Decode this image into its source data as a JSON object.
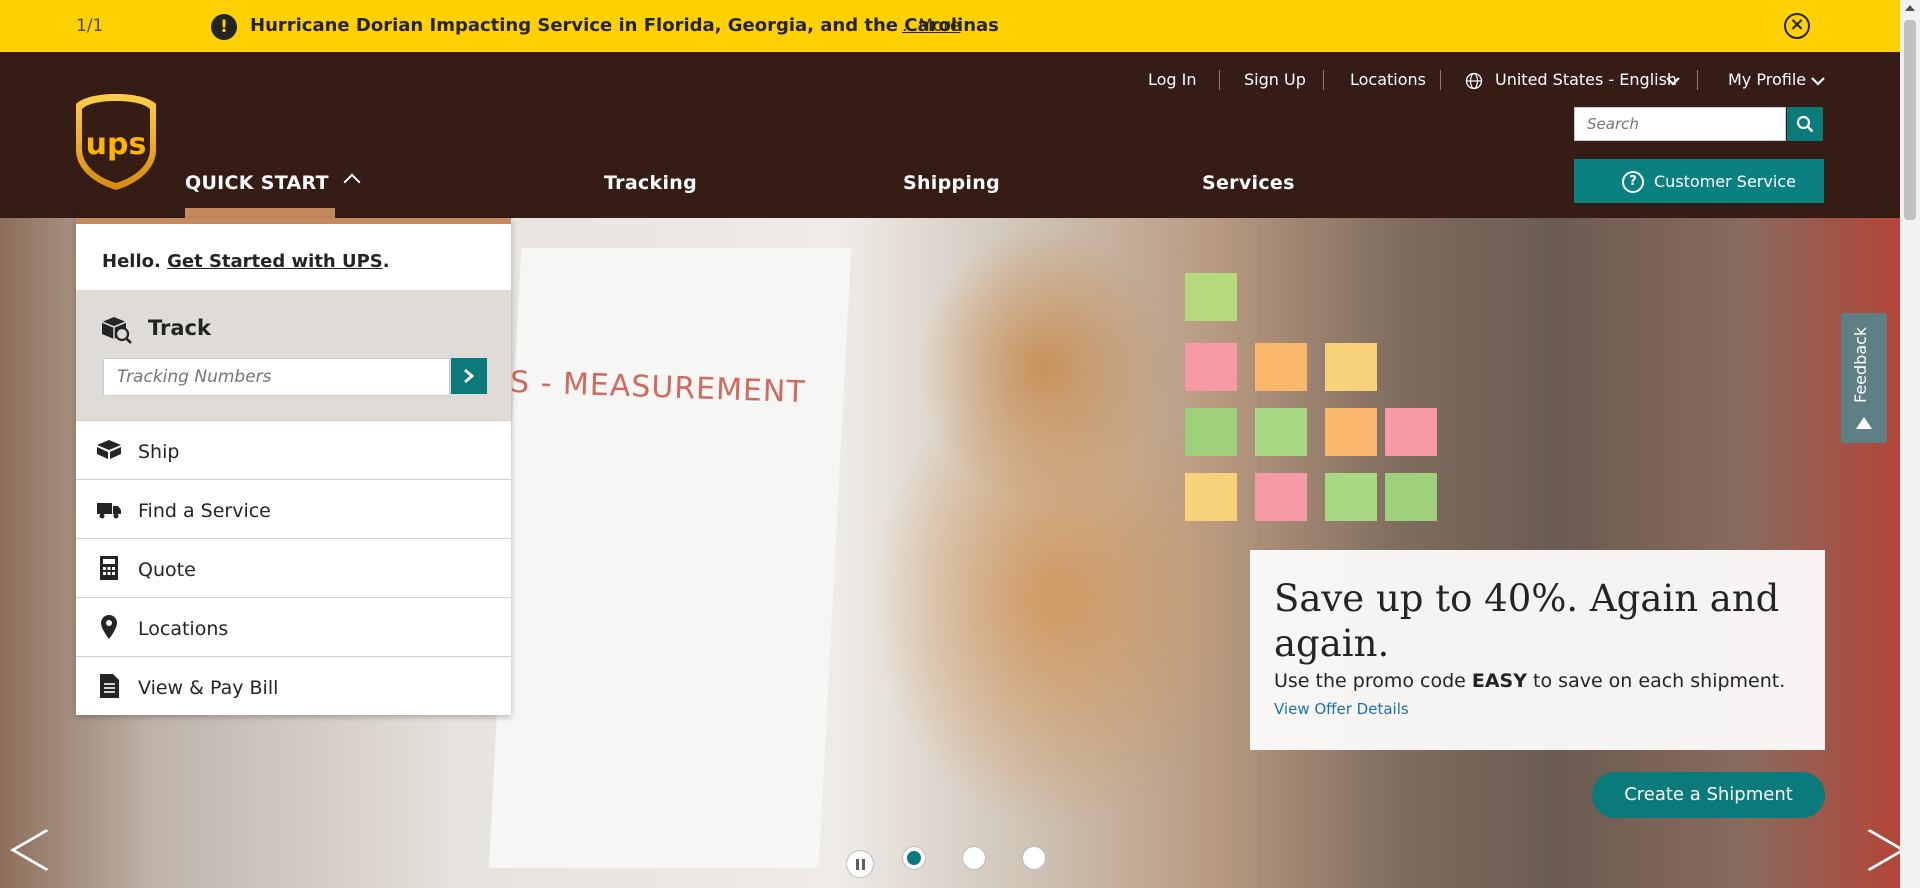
{
  "alert": {
    "counter": "1/1",
    "message": "Hurricane Dorian Impacting Service in Florida, Georgia, and the Carolinas",
    "more_link": "...More"
  },
  "utility_nav": {
    "login": "Log In",
    "signup": "Sign Up",
    "locations": "Locations",
    "language": "United States - English",
    "profile": "My Profile"
  },
  "search": {
    "placeholder": "Search"
  },
  "customer_service": "Customer Service",
  "logo_text": "ups",
  "main_nav": {
    "quick_start": "QUICK START",
    "tracking": "Tracking",
    "shipping": "Shipping",
    "services": "Services"
  },
  "quick_start_menu": {
    "hello": "Hello.",
    "get_started": "Get Started with UPS",
    "period": ".",
    "track_title": "Track",
    "track_placeholder": "Tracking Numbers",
    "items": [
      {
        "label": "Ship",
        "icon": "box-icon"
      },
      {
        "label": "Find a Service",
        "icon": "truck-icon"
      },
      {
        "label": "Quote",
        "icon": "calculator-icon"
      },
      {
        "label": "Locations",
        "icon": "map-pin-icon"
      },
      {
        "label": "View & Pay Bill",
        "icon": "document-icon"
      }
    ]
  },
  "hero": {
    "board_text": "S - MEASUREMENT",
    "promo_headline": "Save up to 40%. Again and again.",
    "promo_sub_before": "Use the promo code ",
    "promo_code": "EASY",
    "promo_sub_after": " to save on each shipment.",
    "promo_link": "View Offer Details",
    "cta": "Create a Shipment",
    "slides": 3,
    "active_slide": 1
  },
  "feedback": "Feedback",
  "colors": {
    "alert_bg": "#ffd100",
    "header_bg": "#351c15",
    "teal": "#0a7b7a",
    "gold": "#c58b5e"
  }
}
